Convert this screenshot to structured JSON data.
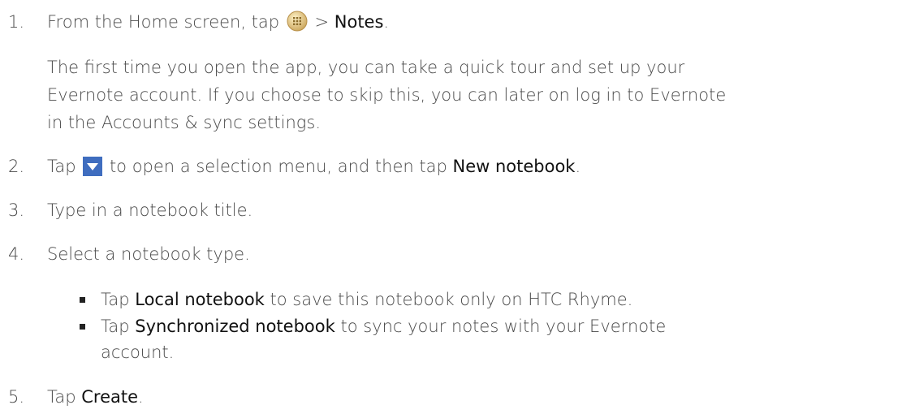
{
  "steps": [
    {
      "number": "1.",
      "pre": "From the Home screen, tap",
      "mid": " > ",
      "bold": "Notes",
      "post": ".",
      "icon": "all-apps-icon"
    },
    {
      "number": "2.",
      "pre": "Tap",
      "mid": "to open a selection menu, and then tap ",
      "bold": "New notebook",
      "post": ".",
      "icon": "dropdown-arrow-icon"
    },
    {
      "number": "3.",
      "text": "Type in a notebook title."
    },
    {
      "number": "4.",
      "text": "Select a notebook type."
    },
    {
      "number": "5.",
      "pre": "Tap ",
      "bold": "Create",
      "post": "."
    }
  ],
  "intro_paragraph": {
    "line1": "The first time you open the app, you can take a quick tour and set up your",
    "line2": "Evernote account. If you choose to skip this, you can later on log in to Evernote",
    "line3": "in the Accounts & sync settings."
  },
  "bullets": [
    {
      "pre": "Tap ",
      "bold": "Local notebook",
      "post": " to save this notebook only on HTC Rhyme."
    },
    {
      "pre": "Tap ",
      "bold": "Synchronized notebook",
      "post": " to sync your notes with your Evernote",
      "cont": "account."
    }
  ],
  "colors": {
    "text": "#4a4a4a",
    "bold_text": "#111111",
    "dropdown_icon": "#3f6dbf"
  }
}
